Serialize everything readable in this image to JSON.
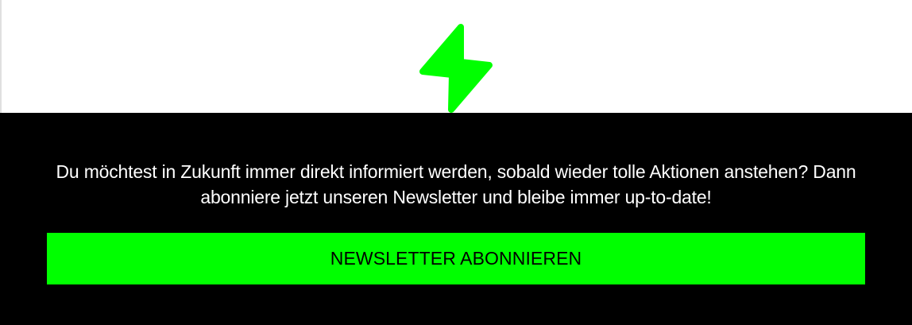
{
  "hero": {
    "icon": "lightning-bolt-icon",
    "accent_color": "#00ff00"
  },
  "newsletter": {
    "message": "Du möchtest in Zukunft immer direkt informiert werden, sobald wieder tolle Aktionen anstehen? Dann abonniere jetzt unseren Newsletter und bleibe immer up-to-date!",
    "button_label": "NEWSLETTER ABONNIEREN",
    "background_color": "#000000",
    "text_color": "#ffffff"
  }
}
